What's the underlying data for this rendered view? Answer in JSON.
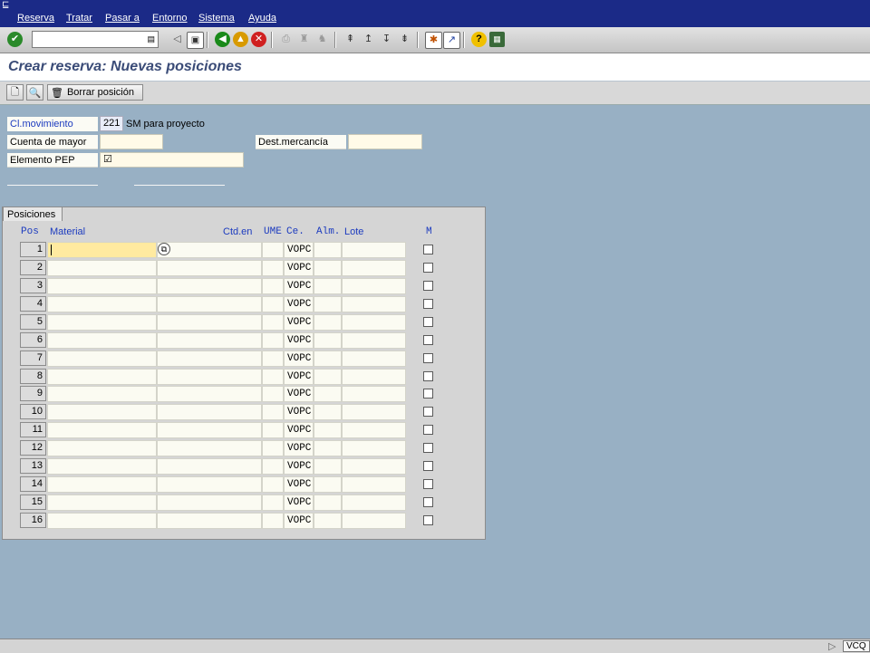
{
  "menu": [
    "Reserva",
    "Tratar",
    "Pasar a",
    "Entorno",
    "Sistema",
    "Ayuda"
  ],
  "title": "Crear reserva: Nuevas posiciones",
  "app_toolbar": {
    "delete_label": "Borrar posición"
  },
  "header": {
    "cl_mov_label": "Cl.movimiento",
    "cl_mov_value": "221",
    "cl_mov_desc": "SM para proyecto",
    "cuenta_label": "Cuenta de mayor",
    "cuenta_value": "",
    "dest_label": "Dest.mercancía",
    "dest_value": "",
    "pep_label": "Elemento PEP",
    "pep_value": "☑"
  },
  "table": {
    "tab_label": "Posiciones",
    "columns": {
      "pos": "Pos",
      "material": "Material",
      "ctd": "Ctd.en",
      "ume": "UME",
      "ce": "Ce.",
      "alm": "Alm.",
      "lote": "Lote",
      "m": "M"
    },
    "rows": [
      {
        "pos": "1",
        "ce": "VOPC"
      },
      {
        "pos": "2",
        "ce": "VOPC"
      },
      {
        "pos": "3",
        "ce": "VOPC"
      },
      {
        "pos": "4",
        "ce": "VOPC"
      },
      {
        "pos": "5",
        "ce": "VOPC"
      },
      {
        "pos": "6",
        "ce": "VOPC"
      },
      {
        "pos": "7",
        "ce": "VOPC"
      },
      {
        "pos": "8",
        "ce": "VOPC"
      },
      {
        "pos": "9",
        "ce": "VOPC"
      },
      {
        "pos": "10",
        "ce": "VOPC"
      },
      {
        "pos": "11",
        "ce": "VOPC"
      },
      {
        "pos": "12",
        "ce": "VOPC"
      },
      {
        "pos": "13",
        "ce": "VOPC"
      },
      {
        "pos": "14",
        "ce": "VOPC"
      },
      {
        "pos": "15",
        "ce": "VOPC"
      },
      {
        "pos": "16",
        "ce": "VOPC"
      }
    ]
  },
  "status": {
    "system": "VCQ"
  },
  "colors": {
    "menubar": "#1b2a87",
    "background": "#98b0c4",
    "label_blue": "#1c3bbf",
    "title": "#3a4b77"
  }
}
